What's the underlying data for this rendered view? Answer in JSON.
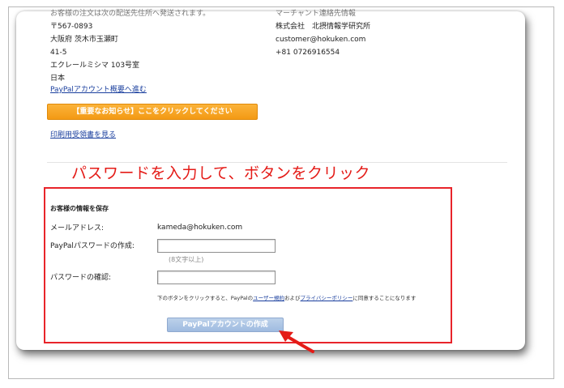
{
  "header": {
    "left_cut_text": "お客様の注文は次の配送先住所へ発送されます。",
    "right_cut_text": "マーチャント連絡先情報"
  },
  "shipping_address": {
    "postal_code": "〒567-0893",
    "line1": "大阪府 茨木市玉瀬町",
    "line2": "41-5",
    "line3": "エクレールミシマ 103号室",
    "country": "日本"
  },
  "merchant": {
    "name": "株式会社　北摂情報学研究所",
    "email": "customer@hokuken.com",
    "phone": "+81 0726916554"
  },
  "links": {
    "account_summary": "PayPalアカウント概要へ進む",
    "print_receipt": "印刷用受領書を見る"
  },
  "notice_button": "【重要なお知らせ】ここをクリックしてください",
  "instruction": "パスワードを入力して、ボタンをクリック",
  "save_form": {
    "heading": "お客様の情報を保存",
    "email_label": "メールアドレス:",
    "email_value": "kameda@hokuken.com",
    "password_label": "PayPalパスワードの作成:",
    "password_value": "",
    "password_hint": "(8文字以上)",
    "confirm_label": "パスワードの確認:",
    "confirm_value": "",
    "legal_prefix": "下のボタンをクリックすると、PayPalの",
    "legal_link1": "ユーザー規約",
    "legal_middle": "および",
    "legal_link2": "プライバシーポリシー",
    "legal_suffix": "に同意することになります",
    "create_button": "PayPalアカウントの作成"
  },
  "colors": {
    "instruction_red": "#e41b17",
    "highlight_box": "#e8242a",
    "notice_orange": "#f39a14",
    "create_button_blue": "#a9c2e4",
    "link_blue": "#1a3f9e"
  }
}
